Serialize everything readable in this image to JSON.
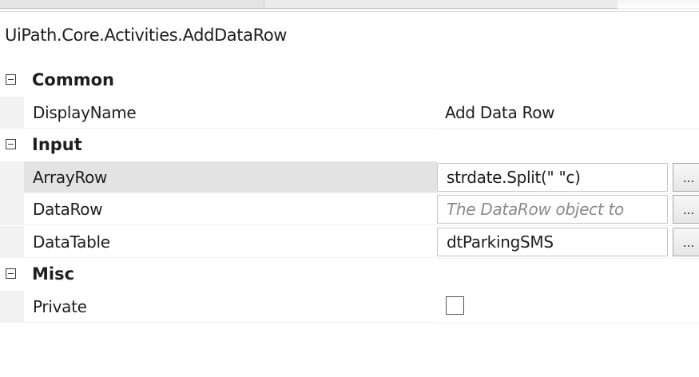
{
  "activity_type": "UiPath.Core.Activities.AddDataRow",
  "categories": [
    {
      "label": "Common",
      "properties": [
        {
          "name": "DisplayName",
          "value": "Add Data Row"
        }
      ]
    },
    {
      "label": "Input",
      "properties": [
        {
          "name": "ArrayRow",
          "value": "strdate.Split(\" \"c)"
        },
        {
          "name": "DataRow",
          "placeholder": "The DataRow object to"
        },
        {
          "name": "DataTable",
          "value": "dtParkingSMS"
        }
      ]
    },
    {
      "label": "Misc",
      "properties": [
        {
          "name": "Private",
          "checked": false
        }
      ]
    }
  ],
  "ellipsis_label": "..."
}
